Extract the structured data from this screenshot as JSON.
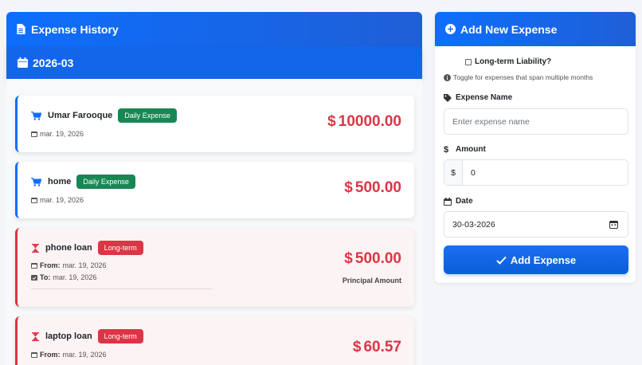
{
  "history": {
    "title": "Expense History",
    "month": "2026-03",
    "currency_symbol": "$",
    "items": [
      {
        "name": "Umar Farooque",
        "badge": "Daily Expense",
        "date": "mar. 19, 2026",
        "amount": "10000.00"
      },
      {
        "name": "home",
        "badge": "Daily Expense",
        "date": "mar. 19, 2026",
        "amount": "500.00"
      },
      {
        "name": "phone loan",
        "badge": "Long-term",
        "from_label": "From:",
        "from": "mar. 19, 2026",
        "to_label": "To:",
        "to": "mar. 19, 2026",
        "amount": "500.00",
        "sub_label": "Principal Amount"
      },
      {
        "name": "laptop loan",
        "badge": "Long-term",
        "from_label": "From:",
        "from": "mar. 19, 2026",
        "amount": "60.57"
      }
    ]
  },
  "form": {
    "title": "Add New Expense",
    "long_term_label": "Long-term Liability?",
    "long_term_checked": false,
    "hint": "Toggle for expenses that span multiple months",
    "name_label": "Expense Name",
    "name_placeholder": "Enter expense name",
    "amount_label": "Amount",
    "amount_prefix": "$",
    "amount_value": "0",
    "date_label": "Date",
    "date_value": "30-03-2026",
    "submit_label": "Add Expense"
  },
  "colors": {
    "primary": "#0d6efd",
    "danger": "#dc3545",
    "success": "#198754"
  },
  "icons": [
    "file-icon",
    "calendar-icon",
    "cart-icon",
    "hourglass-icon",
    "plus-circle-icon",
    "info-icon",
    "tag-icon",
    "dollar-icon",
    "check-icon"
  ]
}
